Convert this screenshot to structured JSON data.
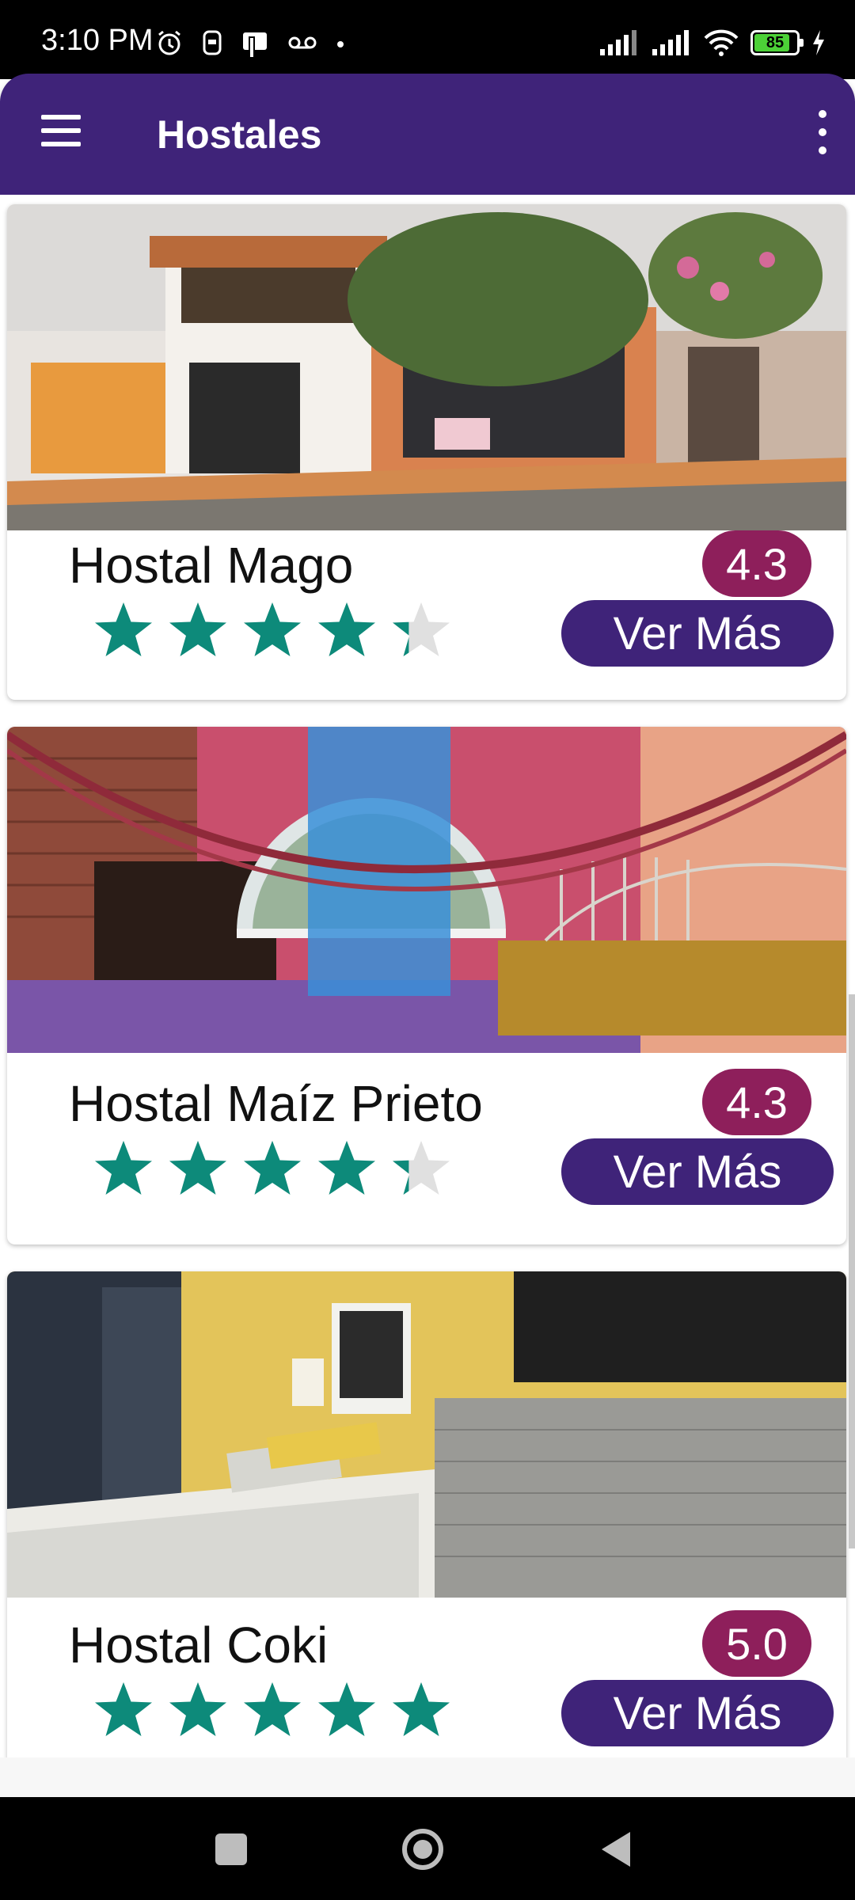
{
  "status_bar": {
    "time": "3:10 PM",
    "battery": "85",
    "battery_level": 0.85,
    "icons": [
      "alarm-icon",
      "sim-icon",
      "nfc-icon",
      "voicemail-icon",
      "dot-icon",
      "signal-icon",
      "signal-icon",
      "wifi-icon",
      "battery-icon",
      "charging-icon"
    ]
  },
  "app_bar": {
    "title": "Hostales",
    "menu_icon": "hamburger-menu-icon",
    "overflow_icon": "more-vert-icon"
  },
  "hostels": [
    {
      "name": "Hostal Mago",
      "rating": "4.3",
      "stars": 4.3,
      "button": "Ver Más",
      "image": "hostel-facade-photo"
    },
    {
      "name": "Hostal Maíz Prieto",
      "rating": "4.3",
      "stars": 4.3,
      "button": "Ver Más",
      "image": "hostel-room-hammock-photo"
    },
    {
      "name": "Hostal Coki",
      "rating": "5.0",
      "stars": 5.0,
      "button": "Ver Más",
      "image": "hostel-reception-photo"
    }
  ],
  "colors": {
    "primary": "#3f2379",
    "badge": "#8e1f5b",
    "star_filled": "#0d8a7a",
    "star_empty": "#e0e0e0"
  },
  "nav_bar": {
    "icons": [
      "recent-apps-icon",
      "home-icon",
      "back-icon"
    ]
  }
}
